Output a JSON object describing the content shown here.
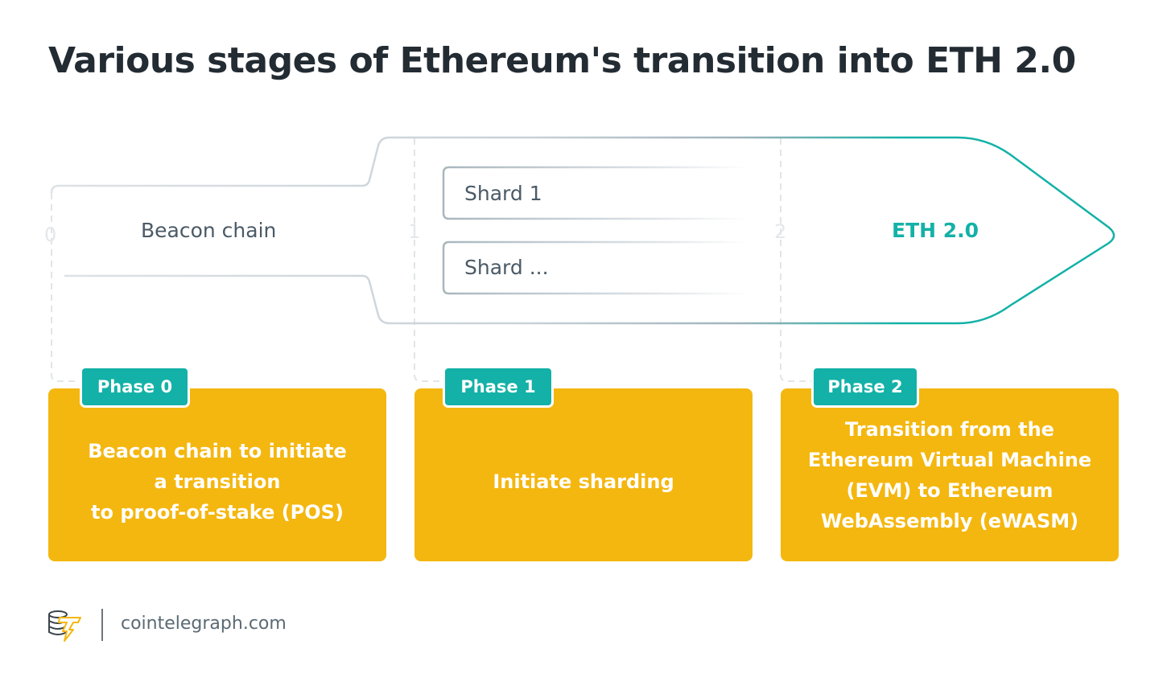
{
  "title": "Various stages of Ethereum's transition into ETH 2.0",
  "stages": [
    {
      "number": "0",
      "label": "Beacon chain"
    },
    {
      "number": "1",
      "shards": [
        "Shard 1",
        "Shard ..."
      ]
    },
    {
      "number": "2",
      "label": "ETH 2.0"
    }
  ],
  "phases": [
    {
      "tab": "Phase 0",
      "description": "Beacon chain to initiate\na transition\nto proof-of-stake (POS)"
    },
    {
      "tab": "Phase 1",
      "description": "Initiate sharding"
    },
    {
      "tab": "Phase 2",
      "description": "Transition from the\nEthereum Virtual Machine\n(EVM) to Ethereum\nWebAssembly (eWASM)"
    }
  ],
  "footer": {
    "logo_icon": "cointelegraph-logo-icon",
    "site": "cointelegraph.com"
  },
  "colors": {
    "accent_teal": "#13b1a7",
    "card_yellow": "#f4b70f",
    "title_dark": "#232b33"
  }
}
